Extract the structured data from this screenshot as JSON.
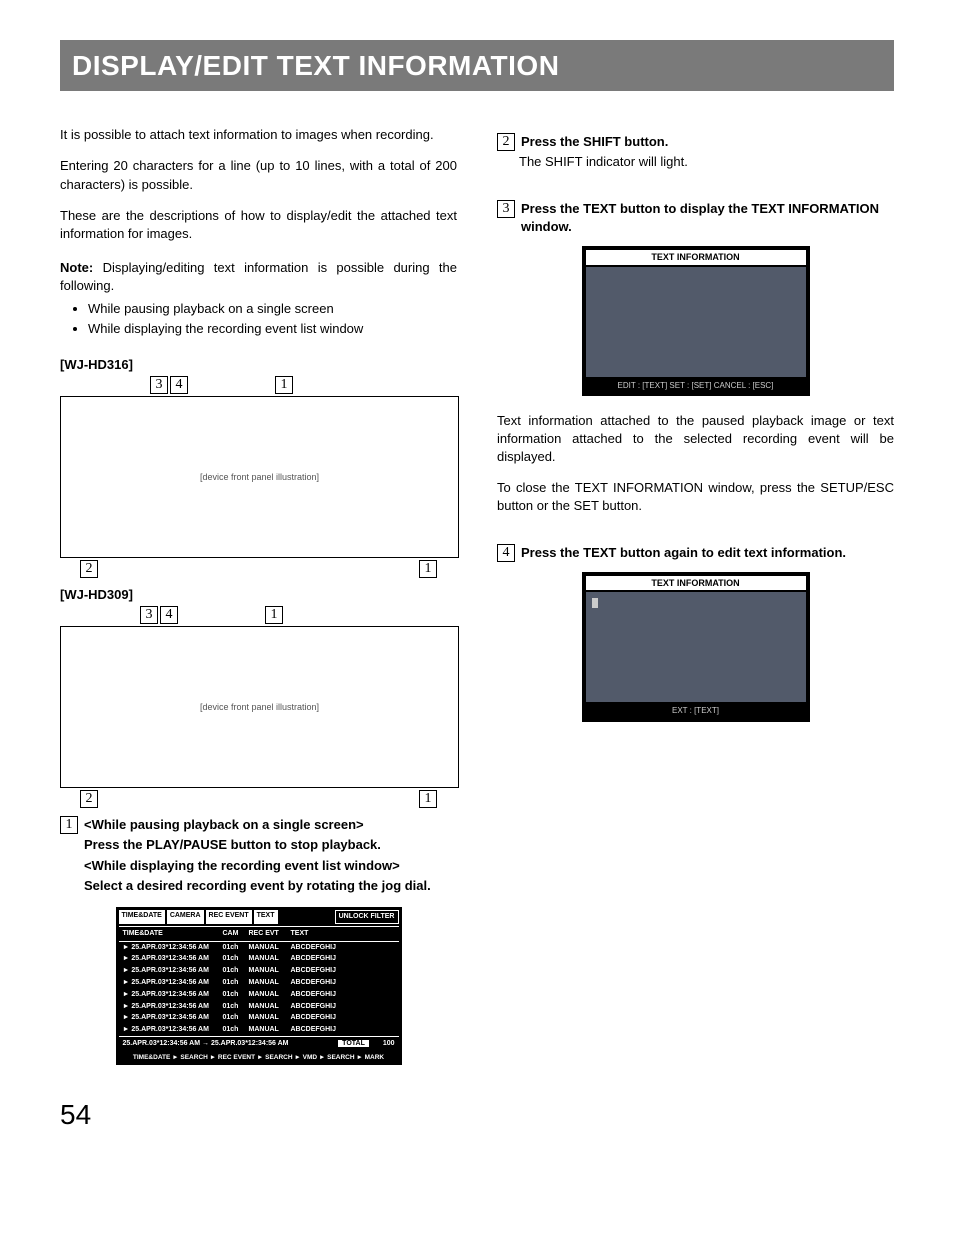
{
  "title": "DISPLAY/EDIT TEXT INFORMATION",
  "intro": {
    "p1": "It is possible to attach text information to images when recording.",
    "p2": "Entering 20 characters for a line (up to 10 lines, with a total of 200 characters) is possible.",
    "p3": "These are the descriptions of how to display/edit the attached text information for images."
  },
  "note": {
    "label": "Note:",
    "text": "Displaying/editing text information is possible during the following.",
    "bullets": [
      "While pausing playback on a single screen",
      "While displaying the recording event list window"
    ]
  },
  "models": {
    "a": "[WJ-HD316]",
    "b": "[WJ-HD309]"
  },
  "step1": {
    "line1": "<While pausing playback on a single screen>",
    "line2": "Press the PLAY/PAUSE button to stop playback.",
    "line3": "<While displaying the recording event list window>",
    "line4": "Select a desired recording event by rotating the jog dial."
  },
  "event_table": {
    "tabs": [
      "TIME&DATE",
      "CAMERA",
      "REC EVENT",
      "TEXT"
    ],
    "unlock": "UNLOCK FILTER",
    "headers": [
      "TIME&DATE",
      "CAM",
      "REC EVT",
      "TEXT"
    ],
    "row": {
      "datetime": "► 25.APR.03*12:34:56 AM",
      "cam": "01ch",
      "evt": "MANUAL",
      "text": "ABCDEFGHIJ"
    },
    "footer_range": "25.APR.03*12:34:56 AM → 25.APR.03*12:34:56 AM",
    "total_label": "TOTAL",
    "total_value": "100",
    "footer_nav": "TIME&DATE ► SEARCH ► REC EVENT ► SEARCH ► VMD ► SEARCH ► MARK"
  },
  "step2": {
    "heading": "Press the SHIFT button.",
    "body": "The SHIFT indicator will light."
  },
  "step3": {
    "heading": "Press the TEXT button to display the TEXT INFORMATION window.",
    "window_title": "TEXT INFORMATION",
    "window_footer": "EDIT : [TEXT]  SET : [SET]  CANCEL : [ESC]",
    "body1": "Text information attached to the paused playback image or text information attached to the selected recording event will be displayed.",
    "body2": "To close the TEXT INFORMATION window, press the SETUP/ESC button or the SET button."
  },
  "step4": {
    "heading": "Press the TEXT button again to edit text information.",
    "window_title": "TEXT INFORMATION",
    "window_footer": "EXT : [TEXT]"
  },
  "page_number": "54"
}
